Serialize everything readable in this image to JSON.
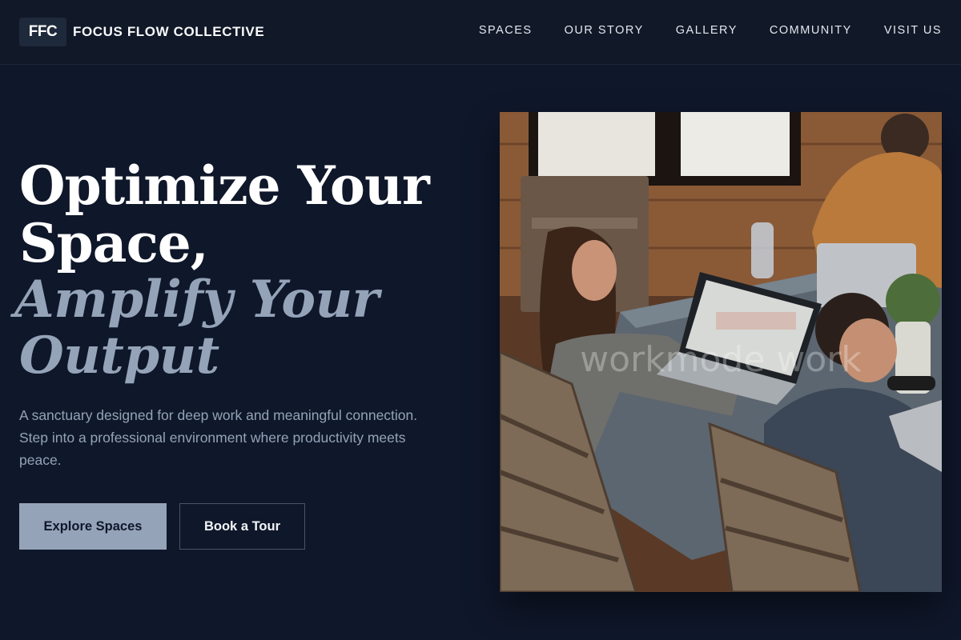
{
  "header": {
    "logo_text": "FFC",
    "brand": "FOCUS FLOW COLLECTIVE",
    "nav": [
      "SPACES",
      "OUR STORY",
      "GALLERY",
      "COMMUNITY",
      "VISIT US"
    ]
  },
  "hero": {
    "headline_line1": "Optimize Your",
    "headline_line2": "Space,",
    "headline_line3": "Amplify Your",
    "headline_line4": "Output",
    "description": "A sanctuary designed for deep work and meaningful connection. Step into a professional environment where productivity meets peace.",
    "primary_button": "Explore Spaces",
    "secondary_button": "Book a Tour",
    "image_watermark": "workmode work"
  },
  "colors": {
    "background": "#0f172a",
    "header_bg": "#111827",
    "accent_muted": "#94a3b8",
    "text_light": "#f1f5f9"
  }
}
